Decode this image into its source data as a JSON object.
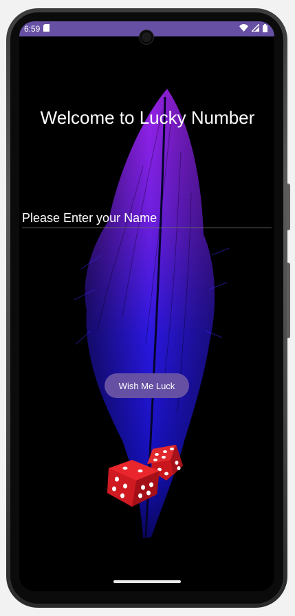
{
  "status_bar": {
    "time": "6:59",
    "color": "#6650a4",
    "icons": [
      "sd-card-icon",
      "wifi-icon",
      "signal-icon",
      "battery-icon"
    ]
  },
  "main": {
    "title": "Welcome to Lucky Number",
    "name_field": {
      "placeholder": "Please Enter your Name",
      "value": ""
    },
    "wish_button_label": "Wish Me Luck",
    "accent": "#6650a4"
  },
  "images": [
    "feather-image",
    "dice-image"
  ]
}
